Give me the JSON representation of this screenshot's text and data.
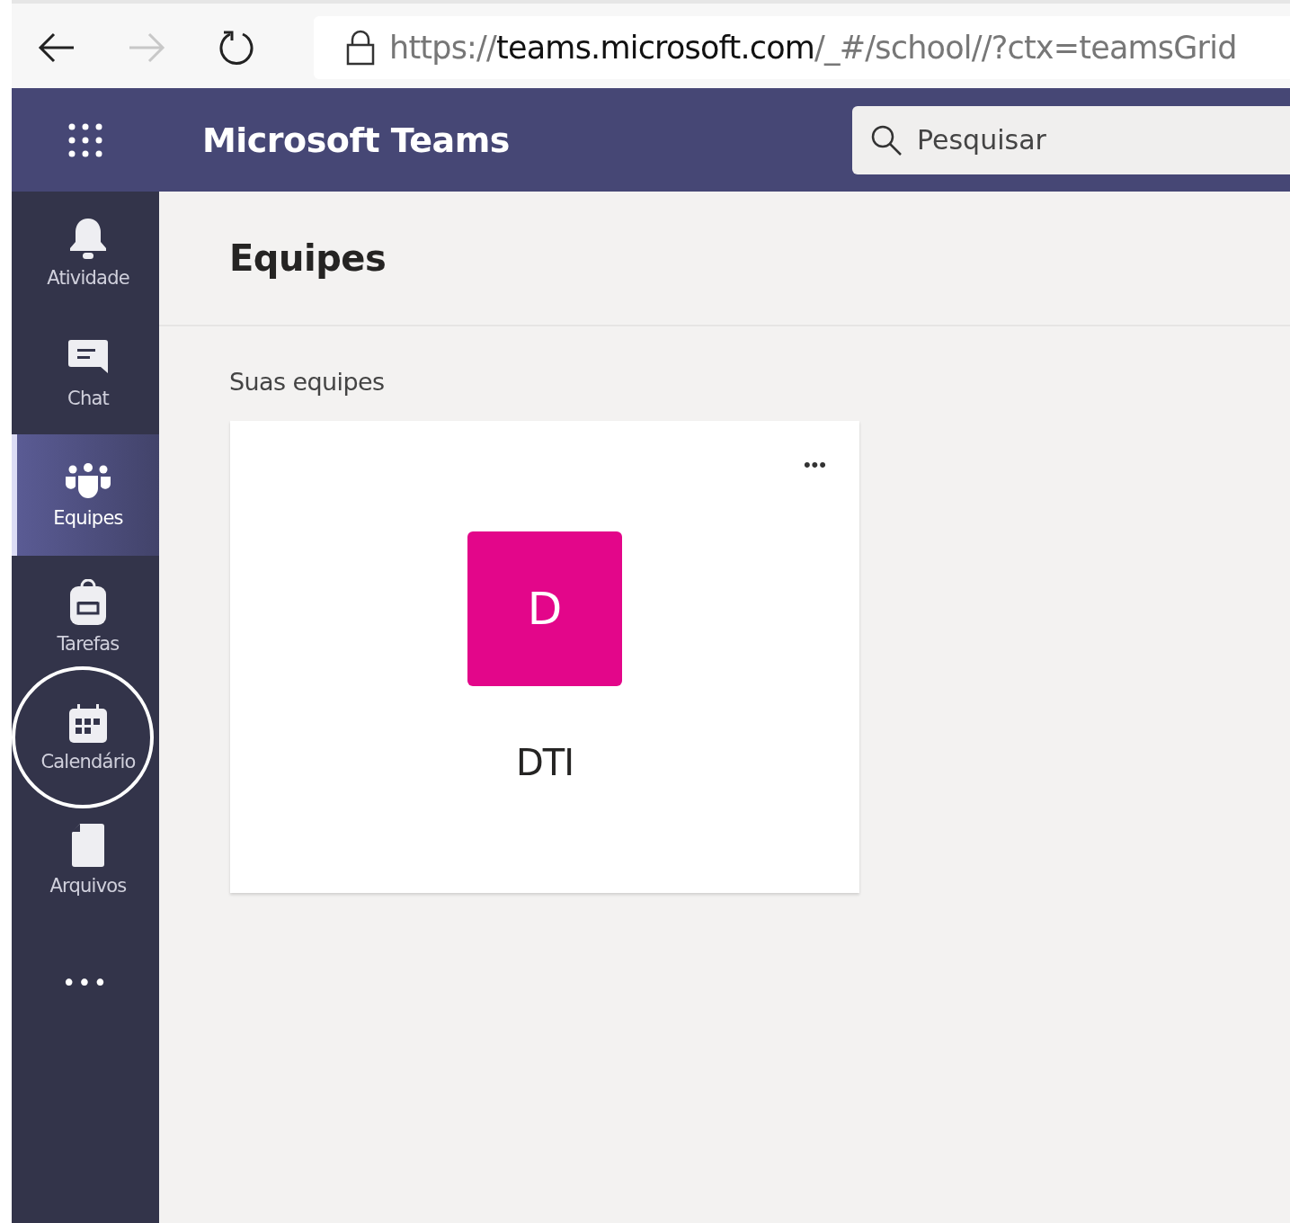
{
  "browser": {
    "url": {
      "scheme": "https://",
      "host": "teams.microsoft.com",
      "path": "/_#/school//?ctx=teamsGrid"
    }
  },
  "header": {
    "title": "Microsoft Teams",
    "search": {
      "placeholder": "Pesquisar"
    }
  },
  "rail": {
    "items": [
      {
        "kind": "bell",
        "label": "Atividade",
        "selected": false,
        "highlighted": false
      },
      {
        "kind": "chat",
        "label": "Chat",
        "selected": false,
        "highlighted": false
      },
      {
        "kind": "teams",
        "label": "Equipes",
        "selected": true,
        "highlighted": false
      },
      {
        "kind": "backpack",
        "label": "Tarefas",
        "selected": false,
        "highlighted": false
      },
      {
        "kind": "calendar",
        "label": "Calendário",
        "selected": false,
        "highlighted": true
      },
      {
        "kind": "file",
        "label": "Arquivos",
        "selected": false,
        "highlighted": false
      }
    ],
    "more": "•••"
  },
  "page": {
    "title": "Equipes",
    "section": "Suas equipes",
    "teams": [
      {
        "initial": "D",
        "name": "DTI",
        "color": "#e3068a",
        "menu": "•••"
      }
    ]
  }
}
